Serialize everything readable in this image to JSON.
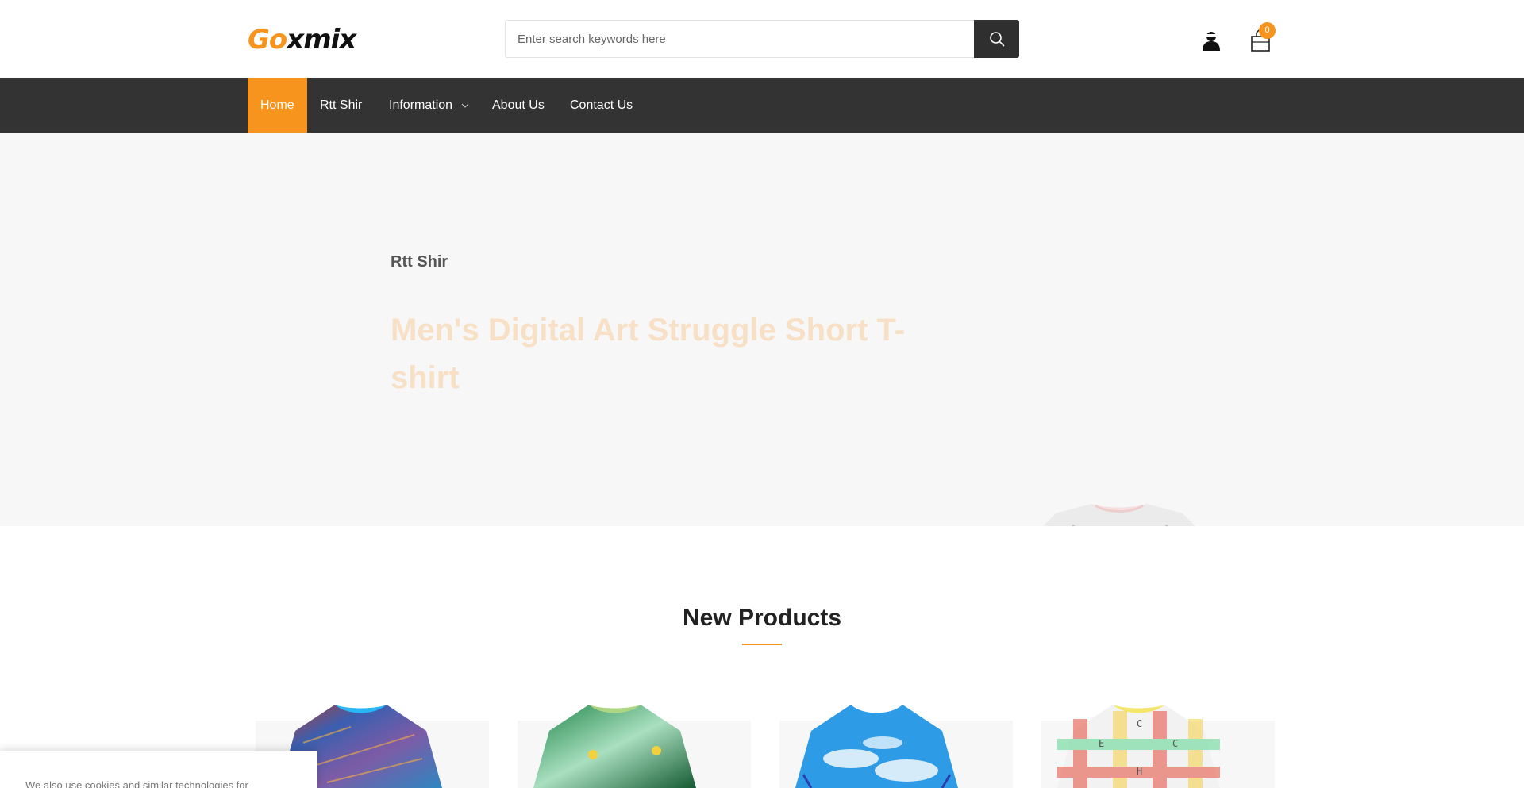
{
  "header": {
    "logo_part1": "Go",
    "logo_part2": "xmix",
    "search": {
      "placeholder": "Enter search keywords here",
      "icon": "search-icon"
    },
    "account_icon": "user-icon",
    "cart": {
      "icon": "shopping-bag-icon",
      "count": "0"
    }
  },
  "nav": {
    "items": [
      {
        "label": "Home",
        "active": true
      },
      {
        "label": "Rtt Shir"
      },
      {
        "label": "Information",
        "has_dropdown": true
      },
      {
        "label": "About Us"
      },
      {
        "label": "Contact Us"
      }
    ]
  },
  "hero": {
    "subtitle": "Rtt Shir",
    "title": "Men's Digital Art Struggle Short T-shirt"
  },
  "new_products": {
    "title": "New Products",
    "items": [
      {
        "image": "tshirt-colorful-abstract"
      },
      {
        "image": "tshirt-green-jungle"
      },
      {
        "image": "tshirt-blue-sky-clouds"
      },
      {
        "image": "tshirt-plaid-letters"
      }
    ]
  },
  "cookie_banner": {
    "text": "We also use cookies and similar technologies for"
  },
  "colors": {
    "accent": "#f7941d",
    "nav_bg": "#333333",
    "hero_bg": "#f7f7f7",
    "search_button_bg": "#2f2f2f"
  }
}
